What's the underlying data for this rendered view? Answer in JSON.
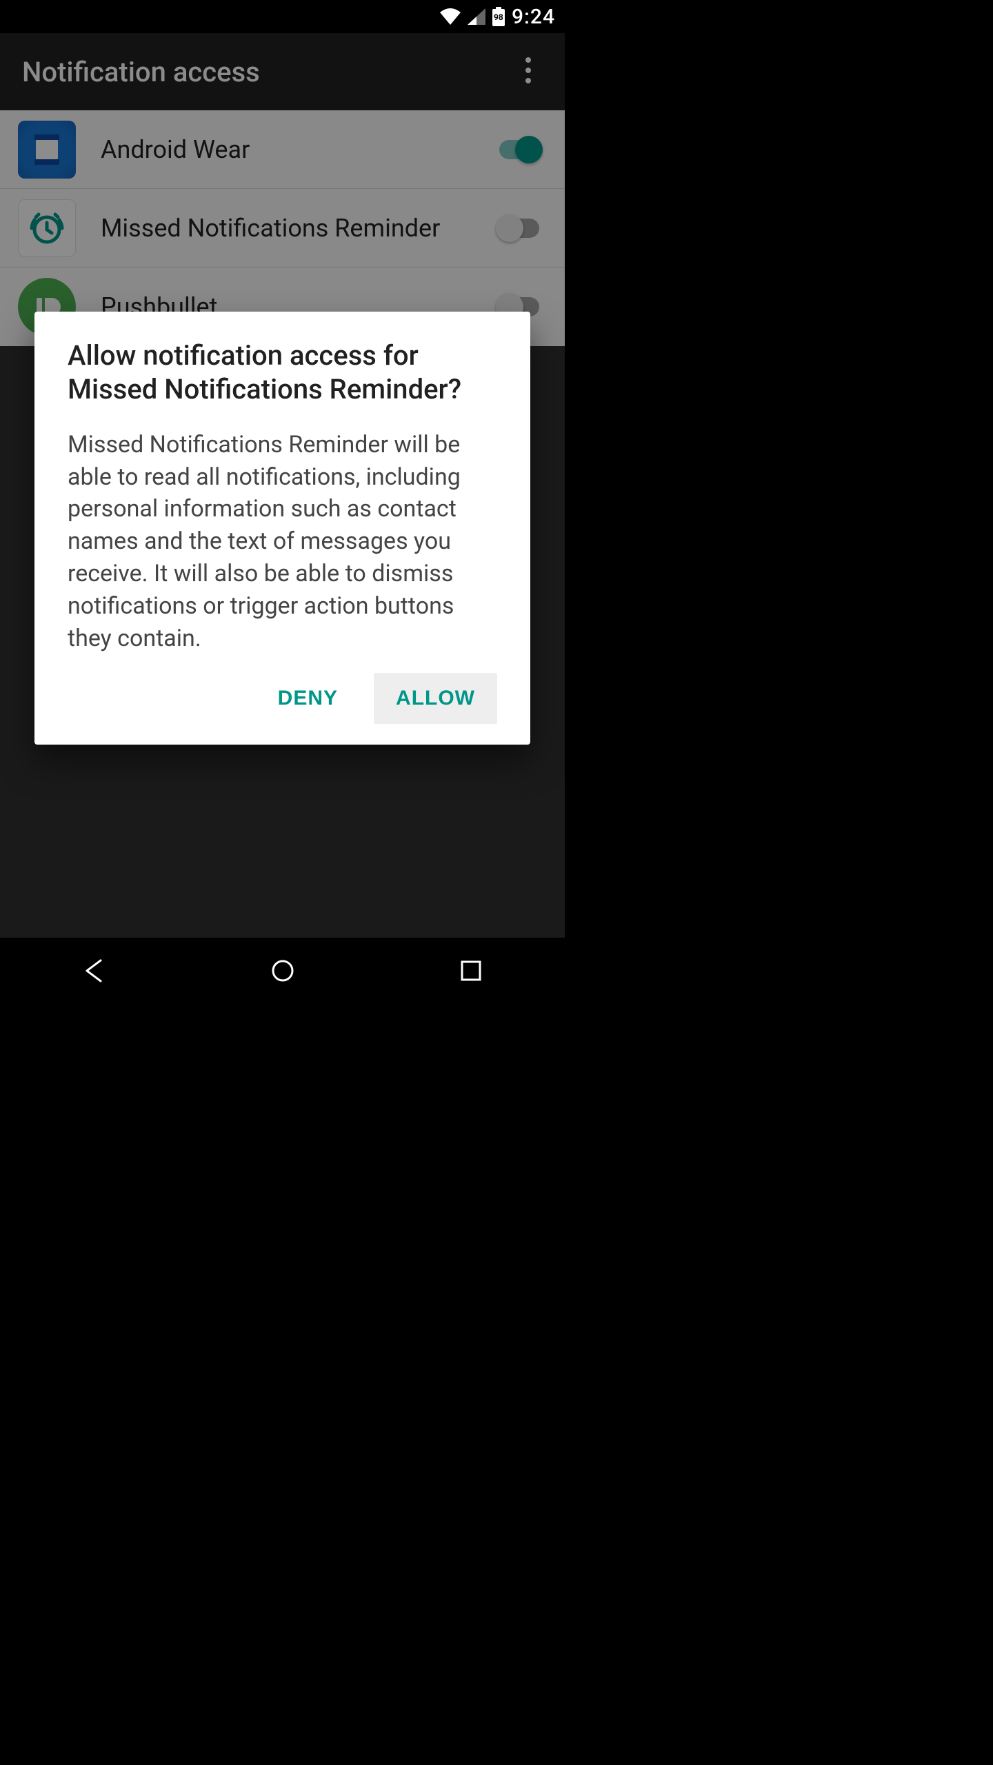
{
  "status": {
    "battery_percent": "98",
    "time": "9:24"
  },
  "appbar": {
    "title": "Notification access"
  },
  "apps": [
    {
      "name": "Android Wear",
      "enabled": true
    },
    {
      "name": "Missed Notifications Reminder",
      "enabled": false
    },
    {
      "name": "Pushbullet",
      "enabled": false
    }
  ],
  "dialog": {
    "title": "Allow notification access for Missed Notifications Reminder?",
    "body": "Missed Notifications Reminder will be able to read all notifications, including personal information such as contact names and the text of messages you receive. It will also be able to dismiss notifications or trigger action buttons they contain.",
    "deny_label": "DENY",
    "allow_label": "ALLOW"
  }
}
